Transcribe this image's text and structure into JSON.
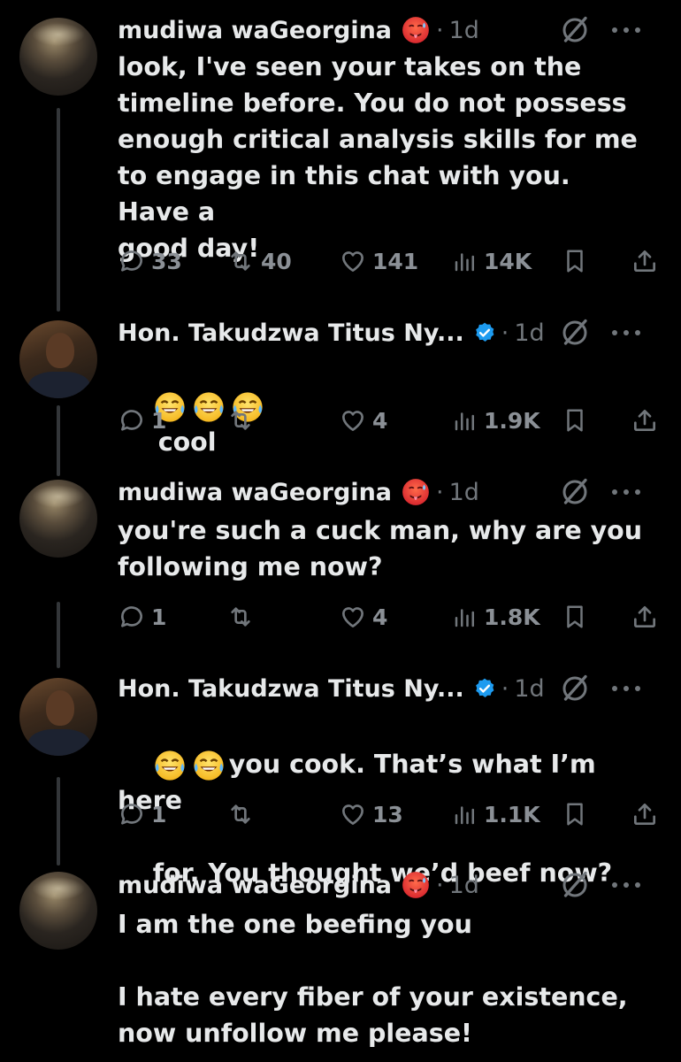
{
  "colors": {
    "background": "#000000",
    "text": "#e7e9ea",
    "muted": "#71767b",
    "verified": "#1d9bf0",
    "thread_line": "#333639"
  },
  "tweets": [
    {
      "author": "mudiwa waGeorgina",
      "badge_icon": "hot-face-emoji",
      "dot": "·",
      "time": "1d",
      "text": "look, I've seen your takes on the\ntimeline before. You do not possess\nenough critical analysis skills for me\nto engage in this chat with you. Have a\ngood day!",
      "replies": "33",
      "reposts": "40",
      "likes": "141",
      "views": "14K"
    },
    {
      "author": "Hon. Takudzwa Titus Ny...",
      "badge_icon": "verified-icon",
      "dot": "·",
      "time": "1d",
      "emoji_count": 3,
      "text": "cool",
      "replies": "1",
      "reposts": "",
      "likes": "4",
      "views": "1.9K"
    },
    {
      "author": "mudiwa waGeorgina",
      "badge_icon": "hot-face-emoji",
      "dot": "·",
      "time": "1d",
      "text": "you're such a cuck man, why are you\nfollowing me now?",
      "replies": "1",
      "reposts": "",
      "likes": "4",
      "views": "1.8K"
    },
    {
      "author": "Hon. Takudzwa Titus Ny...",
      "badge_icon": "verified-icon",
      "dot": "·",
      "time": "1d",
      "emoji_count": 2,
      "text_line1": "you cook. That’s what I’m here",
      "text_line2": "for. You thought we’d beef now?",
      "replies": "1",
      "reposts": "",
      "likes": "13",
      "views": "1.1K"
    },
    {
      "author": "mudiwa waGeorgina",
      "badge_icon": "hot-face-emoji",
      "dot": "·",
      "time": "1d",
      "text": "I am the one beefing you\n\nI hate every fiber of your existence,\nnow unfollow me please!"
    }
  ]
}
